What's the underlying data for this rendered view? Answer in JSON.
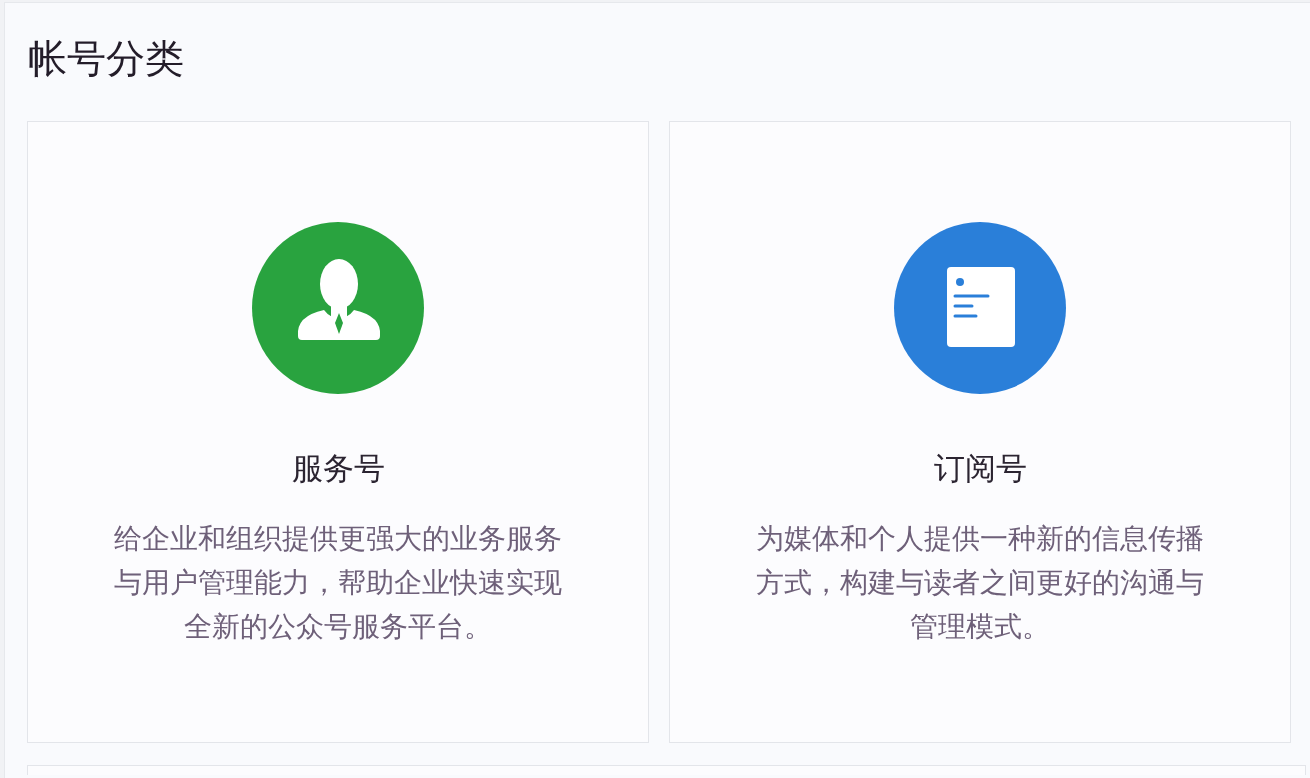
{
  "page": {
    "title": "帐号分类"
  },
  "cards": [
    {
      "kind": "service",
      "color": "#29a33f",
      "title": "服务号",
      "description": "给企业和组织提供更强大的业务服务与用户管理能力，帮助企业快速实现全新的公众号服务平台。"
    },
    {
      "kind": "subscription",
      "color": "#2a7fd9",
      "title": "订阅号",
      "description": "为媒体和个人提供一种新的信息传播方式，构建与读者之间更好的沟通与管理模式。"
    }
  ]
}
